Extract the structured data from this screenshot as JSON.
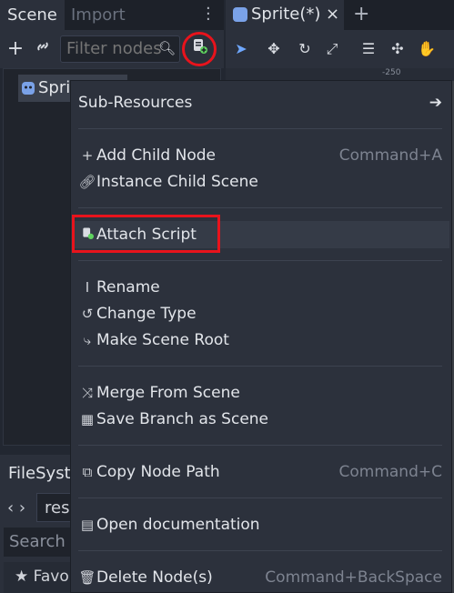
{
  "scene_dock": {
    "tabs": [
      {
        "label": "Scene",
        "active": true
      },
      {
        "label": "Import",
        "active": false
      }
    ],
    "filter_placeholder": "Filter nodes",
    "tree": [
      {
        "label": "Sprite"
      }
    ]
  },
  "filesystem_dock": {
    "title": "FileSystem",
    "path": "res",
    "search_placeholder": "Search f",
    "favorites_label": "Favo"
  },
  "editor": {
    "tab_label": "Sprite(*)",
    "close_glyph": "×",
    "ruler_label": "-250"
  },
  "context_menu": {
    "items": [
      {
        "icon": "arrow-right-icon",
        "label": "Sub-Resources",
        "shortcut": ""
      },
      {
        "icon": "plus-icon",
        "label": "Add Child Node",
        "shortcut": "Command+A"
      },
      {
        "icon": "link-icon",
        "label": "Instance Child Scene",
        "shortcut": ""
      },
      {
        "icon": "script-add-icon",
        "label": "Attach Script",
        "shortcut": ""
      },
      {
        "icon": "rename-icon",
        "label": "Rename",
        "shortcut": ""
      },
      {
        "icon": "rotate-icon",
        "label": "Change Type",
        "shortcut": ""
      },
      {
        "icon": "scene-root-icon",
        "label": "Make Scene Root",
        "shortcut": ""
      },
      {
        "icon": "merge-icon",
        "label": "Merge From Scene",
        "shortcut": ""
      },
      {
        "icon": "save-branch-icon",
        "label": "Save Branch as Scene",
        "shortcut": ""
      },
      {
        "icon": "copy-path-icon",
        "label": "Copy Node Path",
        "shortcut": "Command+C"
      },
      {
        "icon": "doc-icon",
        "label": "Open documentation",
        "shortcut": ""
      },
      {
        "icon": "trash-icon",
        "label": "Delete Node(s)",
        "shortcut": "Command+BackSpace"
      }
    ]
  },
  "colors": {
    "highlight_red": "#e8131c",
    "accent_blue": "#7aa2e8"
  }
}
